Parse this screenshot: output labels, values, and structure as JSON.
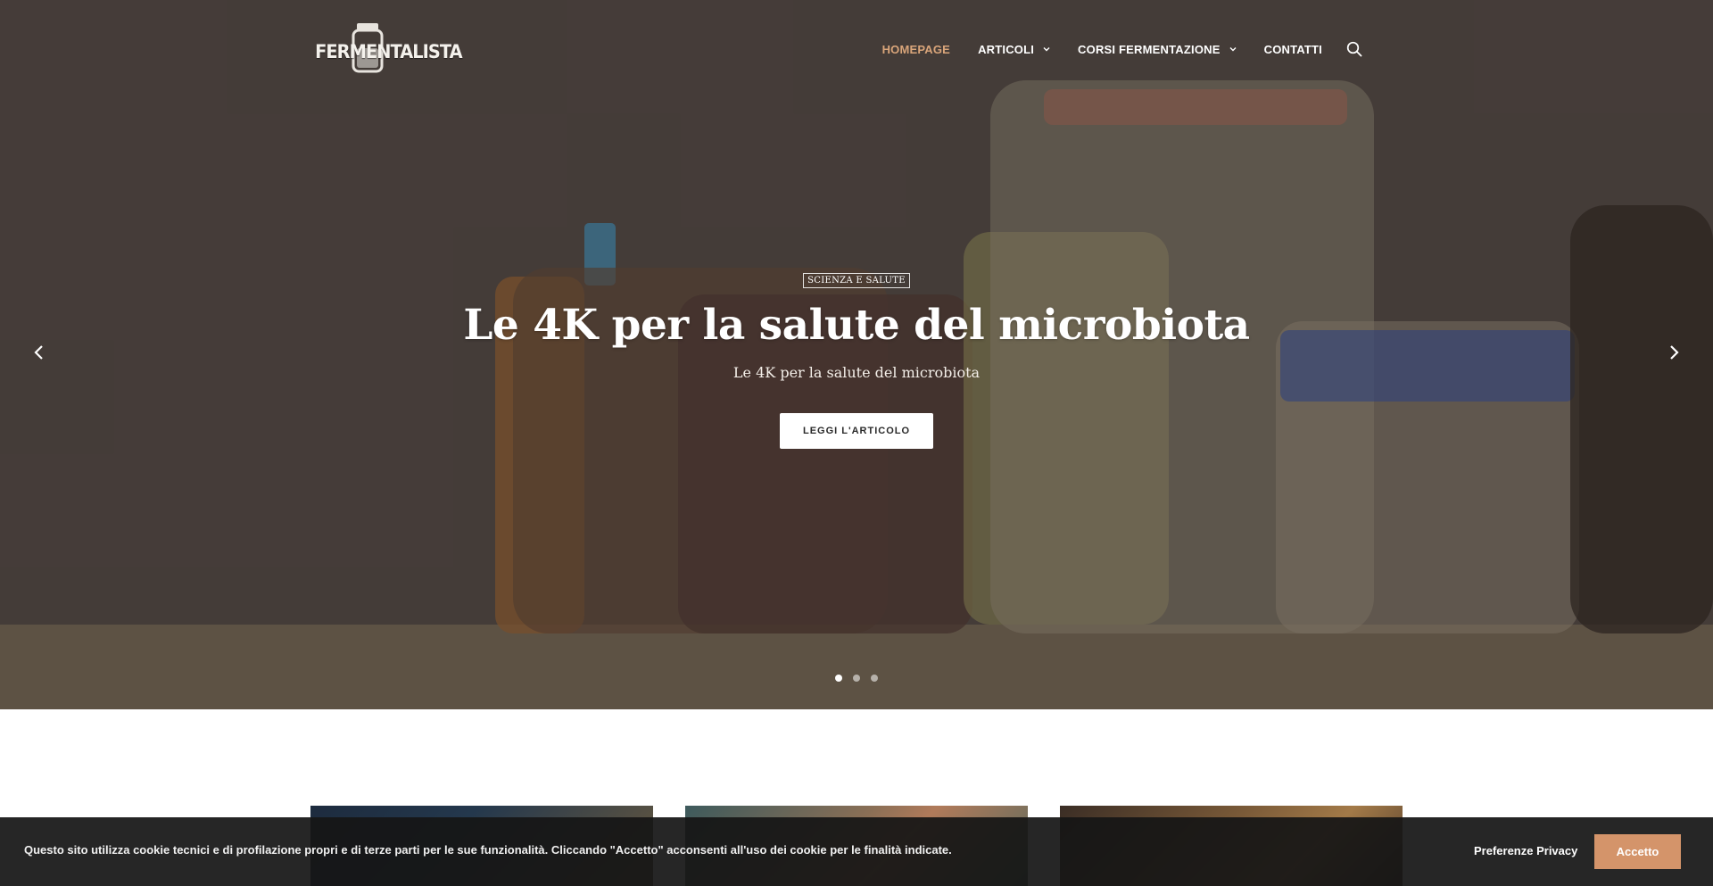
{
  "brand": {
    "logo_text": "FERMENTALISTA"
  },
  "nav": {
    "items": [
      {
        "label": "HOMEPAGE",
        "active": true,
        "has_dropdown": false
      },
      {
        "label": "ARTICOLI",
        "active": false,
        "has_dropdown": true
      },
      {
        "label": "CORSI FERMENTAZIONE",
        "active": false,
        "has_dropdown": true
      },
      {
        "label": "CONTATTI",
        "active": false,
        "has_dropdown": false
      }
    ],
    "search_icon": "search-icon",
    "active_color": "#d9a57a"
  },
  "hero": {
    "category": "SCIENZA E SALUTE",
    "title": "Le 4K per la salute del microbiota",
    "subtitle": "Le 4K per la salute del microbiota",
    "cta_label": "LEGGI L'ARTICOLO",
    "slides_total": 3,
    "active_slide": 1
  },
  "cookie_banner": {
    "text": "Questo sito utilizza cookie tecnici e di profilazione propri e di terze parti per le sue funzionalità. Cliccando \"Accetto\" acconsenti all'uso dei cookie per le finalità indicate.",
    "preferences_label": "Preferenze Privacy",
    "accept_label": "Accetto",
    "accept_color": "#d4946a"
  }
}
